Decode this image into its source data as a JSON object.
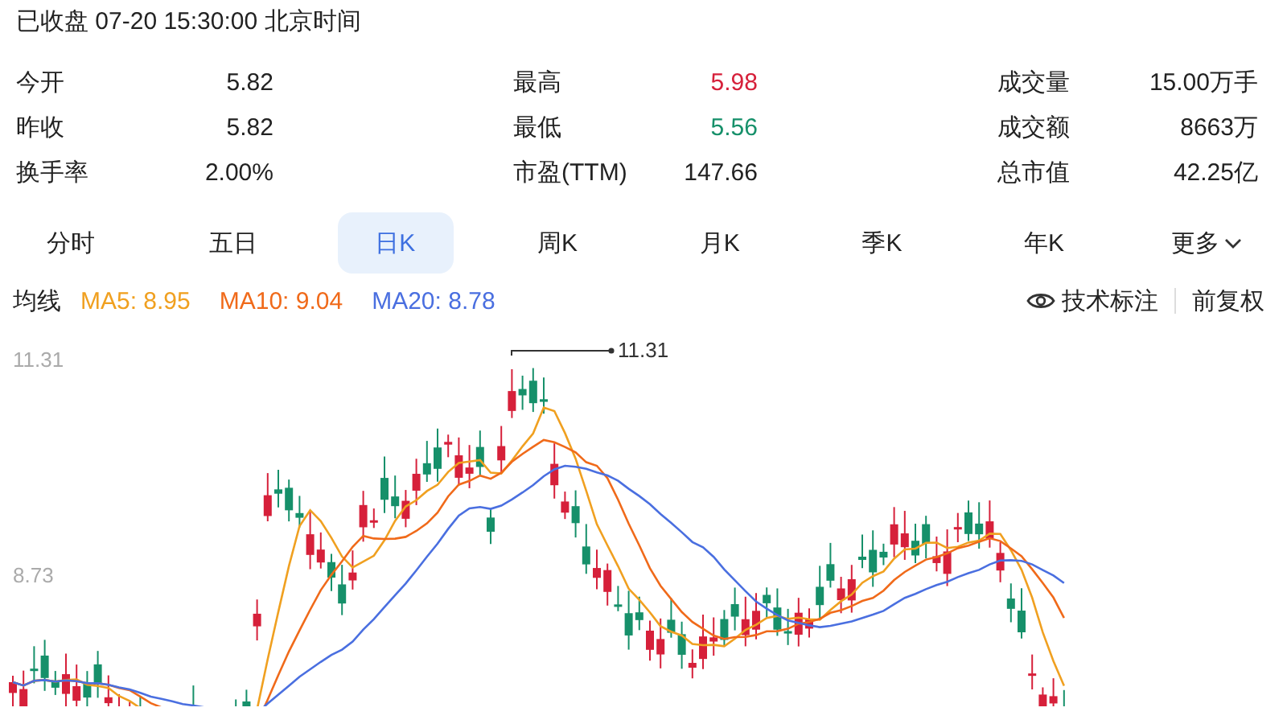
{
  "status": "已收盘 07-20 15:30:00 北京时间",
  "stats": [
    [
      {
        "label": "今开",
        "value": "5.82",
        "color": "#222222"
      },
      {
        "label": "昨收",
        "value": "5.82",
        "color": "#222222"
      },
      {
        "label": "换手率",
        "value": "2.00%",
        "color": "#222222"
      }
    ],
    [
      {
        "label": "最高",
        "value": "5.98",
        "color": "#d6203a"
      },
      {
        "label": "最低",
        "value": "5.56",
        "color": "#16906a"
      },
      {
        "label": "市盈(TTM)",
        "value": "147.66",
        "color": "#222222"
      }
    ],
    [
      {
        "label": "成交量",
        "value": "15.00万手",
        "color": "#222222"
      },
      {
        "label": "成交额",
        "value": "8663万",
        "color": "#222222"
      },
      {
        "label": "总市值",
        "value": "42.25亿",
        "color": "#222222"
      }
    ]
  ],
  "tabs": [
    {
      "label": "分时",
      "selected": false,
      "kind": "tab"
    },
    {
      "label": "五日",
      "selected": false,
      "kind": "tab"
    },
    {
      "label": "日K",
      "selected": true,
      "kind": "tab"
    },
    {
      "label": "周K",
      "selected": false,
      "kind": "tab"
    },
    {
      "label": "月K",
      "selected": false,
      "kind": "tab"
    },
    {
      "label": "季K",
      "selected": false,
      "kind": "tab"
    },
    {
      "label": "年K",
      "selected": false,
      "kind": "tab"
    },
    {
      "label": "更多",
      "selected": false,
      "kind": "menu"
    }
  ],
  "ma_legend": {
    "label": "均线",
    "items": [
      {
        "text": "MA5: 8.95",
        "color": "#f0a020"
      },
      {
        "text": "MA10: 9.04",
        "color": "#f06a1a"
      },
      {
        "text": "MA20: 8.78",
        "color": "#4a6fe0"
      }
    ]
  },
  "tools": [
    {
      "text": "技术标注",
      "kind": "toggle"
    },
    {
      "text": "前复权",
      "kind": "plain"
    }
  ],
  "chart": {
    "y_labels": [
      "11.31",
      "8.73"
    ],
    "max_label": "11.31"
  }
}
